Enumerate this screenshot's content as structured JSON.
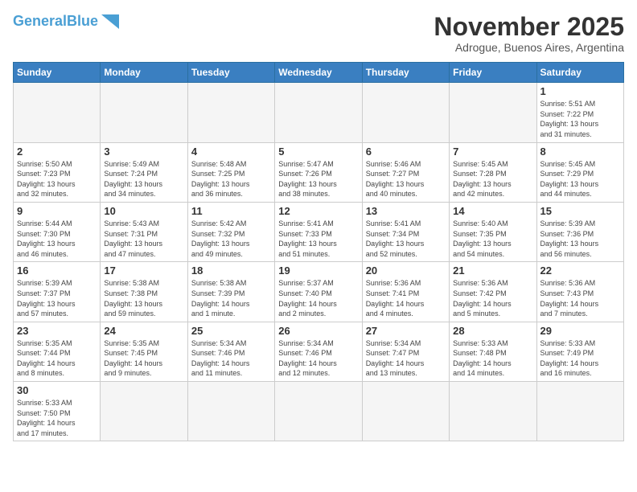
{
  "header": {
    "logo_general": "General",
    "logo_blue": "Blue",
    "month_title": "November 2025",
    "location": "Adrogue, Buenos Aires, Argentina"
  },
  "weekdays": [
    "Sunday",
    "Monday",
    "Tuesday",
    "Wednesday",
    "Thursday",
    "Friday",
    "Saturday"
  ],
  "weeks": [
    [
      {
        "day": "",
        "info": ""
      },
      {
        "day": "",
        "info": ""
      },
      {
        "day": "",
        "info": ""
      },
      {
        "day": "",
        "info": ""
      },
      {
        "day": "",
        "info": ""
      },
      {
        "day": "",
        "info": ""
      },
      {
        "day": "1",
        "info": "Sunrise: 5:51 AM\nSunset: 7:22 PM\nDaylight: 13 hours\nand 31 minutes."
      }
    ],
    [
      {
        "day": "2",
        "info": "Sunrise: 5:50 AM\nSunset: 7:23 PM\nDaylight: 13 hours\nand 32 minutes."
      },
      {
        "day": "3",
        "info": "Sunrise: 5:49 AM\nSunset: 7:24 PM\nDaylight: 13 hours\nand 34 minutes."
      },
      {
        "day": "4",
        "info": "Sunrise: 5:48 AM\nSunset: 7:25 PM\nDaylight: 13 hours\nand 36 minutes."
      },
      {
        "day": "5",
        "info": "Sunrise: 5:47 AM\nSunset: 7:26 PM\nDaylight: 13 hours\nand 38 minutes."
      },
      {
        "day": "6",
        "info": "Sunrise: 5:46 AM\nSunset: 7:27 PM\nDaylight: 13 hours\nand 40 minutes."
      },
      {
        "day": "7",
        "info": "Sunrise: 5:45 AM\nSunset: 7:28 PM\nDaylight: 13 hours\nand 42 minutes."
      },
      {
        "day": "8",
        "info": "Sunrise: 5:45 AM\nSunset: 7:29 PM\nDaylight: 13 hours\nand 44 minutes."
      }
    ],
    [
      {
        "day": "9",
        "info": "Sunrise: 5:44 AM\nSunset: 7:30 PM\nDaylight: 13 hours\nand 46 minutes."
      },
      {
        "day": "10",
        "info": "Sunrise: 5:43 AM\nSunset: 7:31 PM\nDaylight: 13 hours\nand 47 minutes."
      },
      {
        "day": "11",
        "info": "Sunrise: 5:42 AM\nSunset: 7:32 PM\nDaylight: 13 hours\nand 49 minutes."
      },
      {
        "day": "12",
        "info": "Sunrise: 5:41 AM\nSunset: 7:33 PM\nDaylight: 13 hours\nand 51 minutes."
      },
      {
        "day": "13",
        "info": "Sunrise: 5:41 AM\nSunset: 7:34 PM\nDaylight: 13 hours\nand 52 minutes."
      },
      {
        "day": "14",
        "info": "Sunrise: 5:40 AM\nSunset: 7:35 PM\nDaylight: 13 hours\nand 54 minutes."
      },
      {
        "day": "15",
        "info": "Sunrise: 5:39 AM\nSunset: 7:36 PM\nDaylight: 13 hours\nand 56 minutes."
      }
    ],
    [
      {
        "day": "16",
        "info": "Sunrise: 5:39 AM\nSunset: 7:37 PM\nDaylight: 13 hours\nand 57 minutes."
      },
      {
        "day": "17",
        "info": "Sunrise: 5:38 AM\nSunset: 7:38 PM\nDaylight: 13 hours\nand 59 minutes."
      },
      {
        "day": "18",
        "info": "Sunrise: 5:38 AM\nSunset: 7:39 PM\nDaylight: 14 hours\nand 1 minute."
      },
      {
        "day": "19",
        "info": "Sunrise: 5:37 AM\nSunset: 7:40 PM\nDaylight: 14 hours\nand 2 minutes."
      },
      {
        "day": "20",
        "info": "Sunrise: 5:36 AM\nSunset: 7:41 PM\nDaylight: 14 hours\nand 4 minutes."
      },
      {
        "day": "21",
        "info": "Sunrise: 5:36 AM\nSunset: 7:42 PM\nDaylight: 14 hours\nand 5 minutes."
      },
      {
        "day": "22",
        "info": "Sunrise: 5:36 AM\nSunset: 7:43 PM\nDaylight: 14 hours\nand 7 minutes."
      }
    ],
    [
      {
        "day": "23",
        "info": "Sunrise: 5:35 AM\nSunset: 7:44 PM\nDaylight: 14 hours\nand 8 minutes."
      },
      {
        "day": "24",
        "info": "Sunrise: 5:35 AM\nSunset: 7:45 PM\nDaylight: 14 hours\nand 9 minutes."
      },
      {
        "day": "25",
        "info": "Sunrise: 5:34 AM\nSunset: 7:46 PM\nDaylight: 14 hours\nand 11 minutes."
      },
      {
        "day": "26",
        "info": "Sunrise: 5:34 AM\nSunset: 7:46 PM\nDaylight: 14 hours\nand 12 minutes."
      },
      {
        "day": "27",
        "info": "Sunrise: 5:34 AM\nSunset: 7:47 PM\nDaylight: 14 hours\nand 13 minutes."
      },
      {
        "day": "28",
        "info": "Sunrise: 5:33 AM\nSunset: 7:48 PM\nDaylight: 14 hours\nand 14 minutes."
      },
      {
        "day": "29",
        "info": "Sunrise: 5:33 AM\nSunset: 7:49 PM\nDaylight: 14 hours\nand 16 minutes."
      }
    ],
    [
      {
        "day": "30",
        "info": "Sunrise: 5:33 AM\nSunset: 7:50 PM\nDaylight: 14 hours\nand 17 minutes."
      },
      {
        "day": "",
        "info": ""
      },
      {
        "day": "",
        "info": ""
      },
      {
        "day": "",
        "info": ""
      },
      {
        "day": "",
        "info": ""
      },
      {
        "day": "",
        "info": ""
      },
      {
        "day": "",
        "info": ""
      }
    ]
  ]
}
